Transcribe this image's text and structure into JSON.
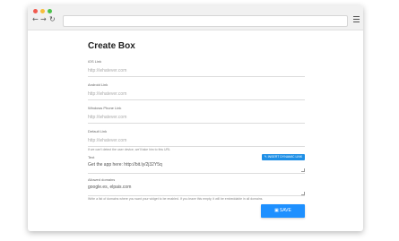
{
  "browser": {
    "nav": {
      "back": "←",
      "forward": "→",
      "reload": "↻"
    }
  },
  "form": {
    "title": "Create Box",
    "ios": {
      "label": "iOS Link",
      "placeholder": "http://whatever.com"
    },
    "android": {
      "label": "Android Link",
      "placeholder": "http://whatever.com"
    },
    "windows": {
      "label": "Windows Phone Link",
      "placeholder": "http://whatever.com"
    },
    "default": {
      "label": "Default Link",
      "placeholder": "http://whatever.com",
      "hint": "If we can't detect the user device, we'll take him to this URL"
    },
    "text": {
      "label": "Text",
      "value": "Get the app here: http://bit.ly/2j32Y5q",
      "insert_label": "✎ INSERT DYNAMIC LINK"
    },
    "domains": {
      "label": "Allowed domains",
      "value": "google.es, elpais.com",
      "hint": "Write a list of domains where you want your widget to be enabled. If you leave this empty, it will be embeddable in all domains."
    },
    "save_label": "SAVE",
    "save_icon": "floppy-icon"
  }
}
